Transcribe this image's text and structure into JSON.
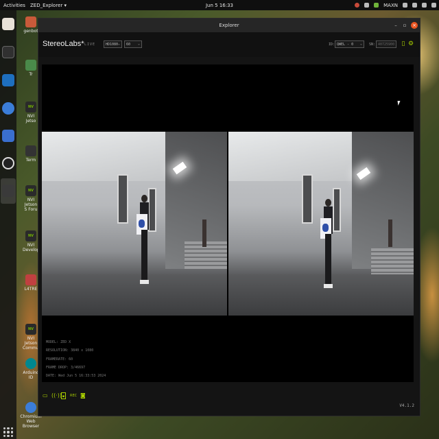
{
  "topbar": {
    "activities": "Activities",
    "app_menu": "ZED_Explorer ▾",
    "clock": "Jun 5  16:33",
    "tray_status": "MAXN"
  },
  "desktop": {
    "items": [
      "genbot",
      "Tr",
      "NVI Jetso",
      "Term",
      "NVI Jetson S Foru",
      "NVI Develop",
      "L4TRE",
      "NVI Jetson Commun",
      "Arduino ID",
      "Chromium Web Browser"
    ]
  },
  "window": {
    "title": "Explorer",
    "minimize": "–",
    "maximize": "▫",
    "close": "×"
  },
  "toolbar": {
    "logo": "StereoLabs*",
    "live_label": "LIVE",
    "resolution_select": "HD1080",
    "fps_select": "60",
    "id_label": "ID:",
    "id_select": "QWEL - 0",
    "sn_label": "SN:",
    "sn_value": "40725900"
  },
  "info": {
    "model": "MODEL: ZED X",
    "resolution": "RESOLUTION: 3840 x 1080",
    "framerate": "FRAMERATE: 60",
    "frame_drop": "FRAME DROP: 3/46697",
    "date": "DATE: Wed Jun 5 16:33:53 2024"
  },
  "bottombar": {
    "rec_label": "REC",
    "version": "V4.1.2"
  },
  "colors": {
    "accent": "#aad000",
    "close_button": "#e95420",
    "window_bg": "#141414"
  },
  "icons": [
    "file-icon",
    "broadcast-icon",
    "sd-record-icon",
    "rec-icon",
    "camera-icon",
    "display-icon",
    "settings-icon"
  ]
}
